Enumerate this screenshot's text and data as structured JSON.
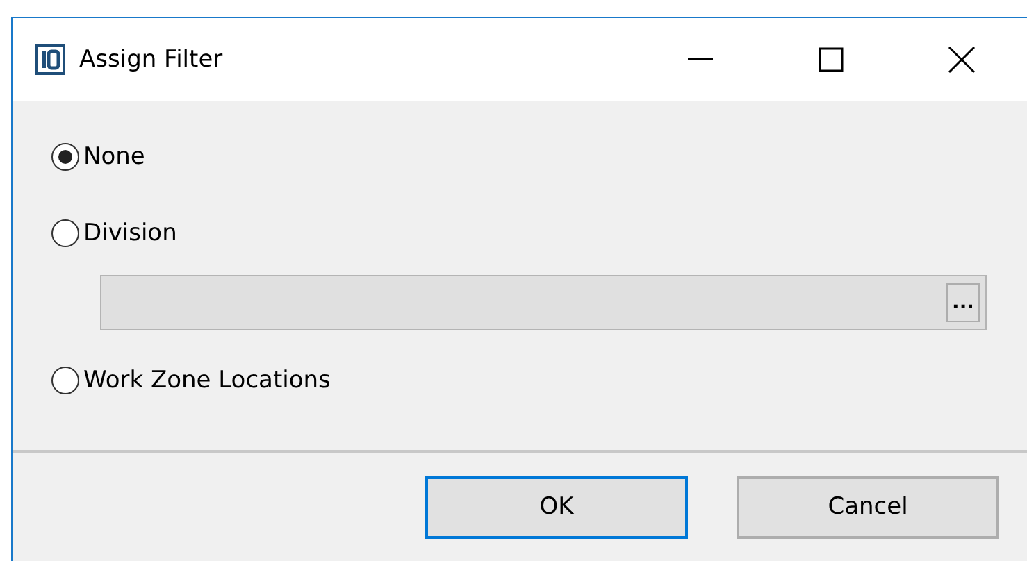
{
  "window": {
    "title": "Assign Filter"
  },
  "options": [
    {
      "label": "None",
      "selected": true
    },
    {
      "label": "Division",
      "selected": false
    },
    {
      "label": "Work Zone Locations",
      "selected": false
    }
  ],
  "division_field": {
    "disabled": true,
    "browse_label": "..."
  },
  "buttons": [
    {
      "label": "OK",
      "default": true
    },
    {
      "label": "Cancel",
      "default": false
    }
  ]
}
